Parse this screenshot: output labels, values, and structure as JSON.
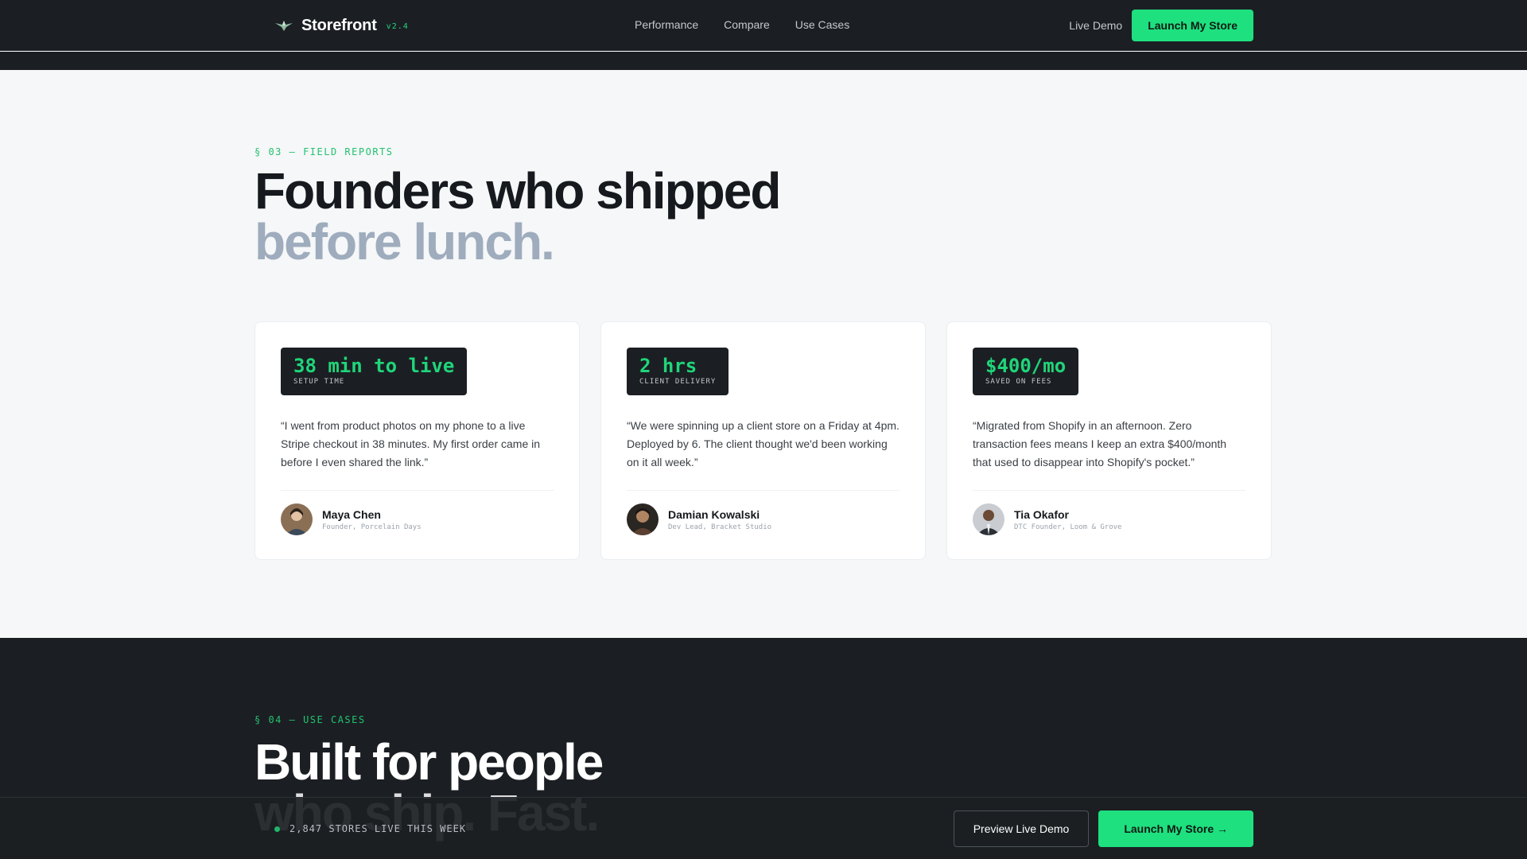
{
  "nav": {
    "brand": "Storefront",
    "version": "v2.4",
    "links": [
      "Performance",
      "Compare",
      "Use Cases"
    ],
    "live_demo": "Live Demo",
    "cta": "Launch My Store"
  },
  "testimonials": {
    "eyebrow": "§ 03 — FIELD REPORTS",
    "title_line1": "Founders who shipped",
    "title_line2": "before lunch.",
    "cards": [
      {
        "stat_value": "38 min to live",
        "stat_label": "SETUP TIME",
        "quote": "“I went from product photos on my phone to a live Stripe checkout in 38 minutes. My first order came in before I even shared the link.”",
        "name": "Maya Chen",
        "role": "Founder, Porcelain Days"
      },
      {
        "stat_value": "2 hrs",
        "stat_label": "CLIENT DELIVERY",
        "quote": "“We were spinning up a client store on a Friday at 4pm. Deployed by 6. The client thought we'd been working on it all week.”",
        "name": "Damian Kowalski",
        "role": "Dev Lead, Bracket Studio"
      },
      {
        "stat_value": "$400/mo",
        "stat_label": "SAVED ON FEES",
        "quote": "“Migrated from Shopify in an afternoon. Zero transaction fees means I keep an extra $400/month that used to disappear into Shopify's pocket.”",
        "name": "Tia Okafor",
        "role": "DTC Founder, Loom & Grove"
      }
    ]
  },
  "use_cases": {
    "eyebrow": "§ 04 — USE CASES",
    "title_line1": "Built for people",
    "title_line2": "who ship. Fast."
  },
  "bottom_bar": {
    "live_count": "2,847 STORES LIVE THIS WEEK",
    "preview": "Preview Live Demo",
    "cta": "Launch My Store →"
  },
  "colors": {
    "accent": "#1ee07f",
    "dark": "#1b1f23",
    "light_bg": "#f5f7f8",
    "muted_heading": "#9eacbd"
  }
}
